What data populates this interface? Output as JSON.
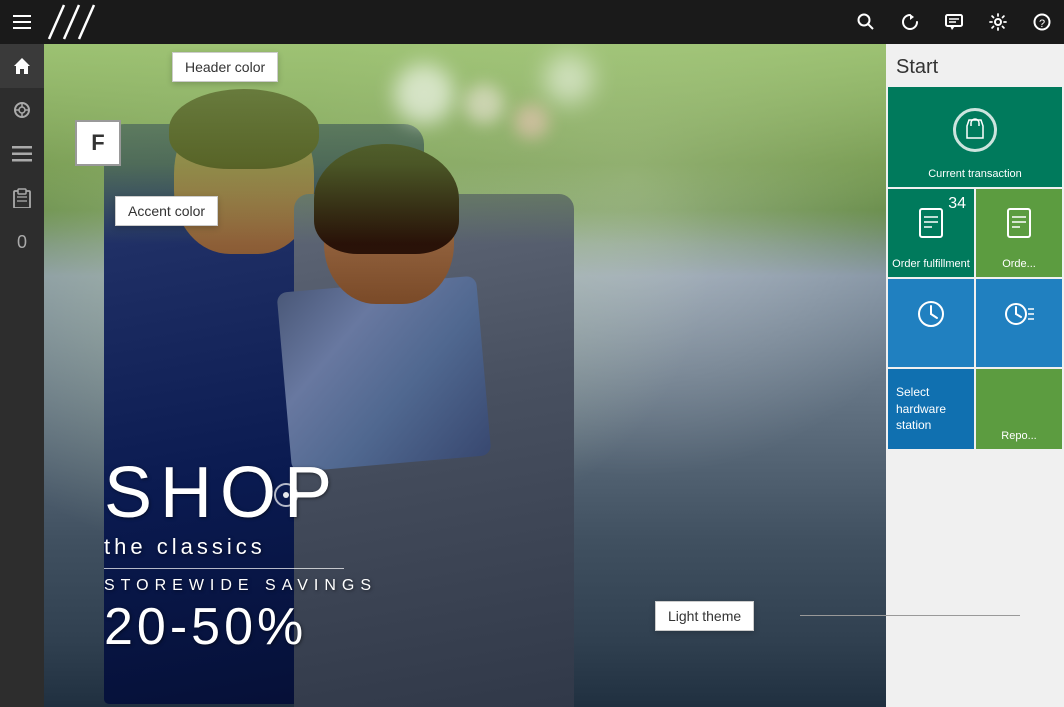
{
  "topbar": {
    "hamburger_label": "☰",
    "icons": {
      "search": "🔍",
      "refresh": "↻",
      "comment": "💬",
      "settings": "⚙",
      "help": "?"
    }
  },
  "sidebar": {
    "items": [
      {
        "id": "home",
        "icon": "⌂",
        "label": "Home",
        "active": true
      },
      {
        "id": "catalog",
        "icon": "◈",
        "label": "Catalog"
      },
      {
        "id": "menu",
        "icon": "≡",
        "label": "Menu"
      },
      {
        "id": "orders",
        "icon": "🛍",
        "label": "Orders"
      },
      {
        "id": "count",
        "icon": "0",
        "label": "Count"
      }
    ]
  },
  "tooltips": {
    "header_color": "Header color",
    "accent_color": "Accent color",
    "light_theme": "Light theme"
  },
  "f_icon": {
    "label": "F"
  },
  "hero": {
    "shop": "SHOP",
    "subtitle": "the classics",
    "savings": "storewide savings",
    "percent": "20-50%"
  },
  "right_panel": {
    "title": "Start",
    "tiles": [
      {
        "id": "current-transaction",
        "label": "Current transaction",
        "color": "#007a5c",
        "badge": "",
        "icon": "bag"
      },
      {
        "id": "order-fulfillment",
        "label": "Order fulfillment",
        "color": "#007a5c",
        "badge": "34",
        "icon": "document"
      },
      {
        "id": "order-right",
        "label": "Orde...",
        "color": "#5c9c40",
        "badge": "",
        "icon": "document"
      },
      {
        "id": "clock1",
        "label": "",
        "color": "#2080c0",
        "badge": "",
        "icon": "clock"
      },
      {
        "id": "clock2",
        "label": "",
        "color": "#2080c0",
        "badge": "",
        "icon": "clock-list"
      },
      {
        "id": "select-hardware",
        "label": "Select hardware station",
        "color": "#1070b0",
        "badge": "",
        "icon": "station"
      },
      {
        "id": "report",
        "label": "Repo...",
        "color": "#5c9c40",
        "badge": "",
        "icon": "report"
      }
    ]
  }
}
